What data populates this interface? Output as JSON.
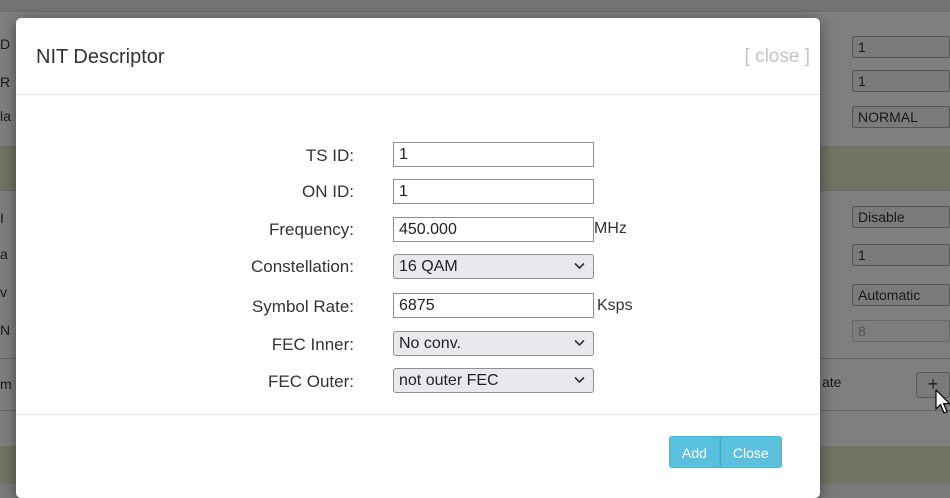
{
  "background": {
    "left_letters": [
      "D",
      "R",
      "la",
      "I",
      "a",
      "v",
      "N",
      "m"
    ],
    "right_fields": [
      "1",
      "1",
      "NORMAL",
      "Disable",
      "1",
      "Automatic",
      "8"
    ],
    "update_fragment": "ate",
    "plus_label": "+"
  },
  "modal": {
    "title": "NIT Descriptor",
    "close_link": "[ close ]"
  },
  "form": {
    "ts_id": {
      "label": "TS ID:",
      "value": "1"
    },
    "on_id": {
      "label": "ON ID:",
      "value": "1"
    },
    "frequency": {
      "label": "Frequency:",
      "value": "450.000",
      "unit": "MHz"
    },
    "constellation": {
      "label": "Constellation:",
      "selected": "16 QAM"
    },
    "symbol_rate": {
      "label": "Symbol Rate:",
      "value": "6875",
      "unit": "Ksps"
    },
    "fec_inner": {
      "label": "FEC Inner:",
      "selected": "No conv."
    },
    "fec_outer": {
      "label": "FEC Outer:",
      "selected": "not outer FEC"
    }
  },
  "footer": {
    "add_label": "Add",
    "close_label": "Close"
  },
  "colors": {
    "button": "#5bc0de",
    "overlay": "rgba(0,0,0,0.5)"
  },
  "icons": [
    "chevron-down-icon",
    "mouse-cursor-icon"
  ]
}
